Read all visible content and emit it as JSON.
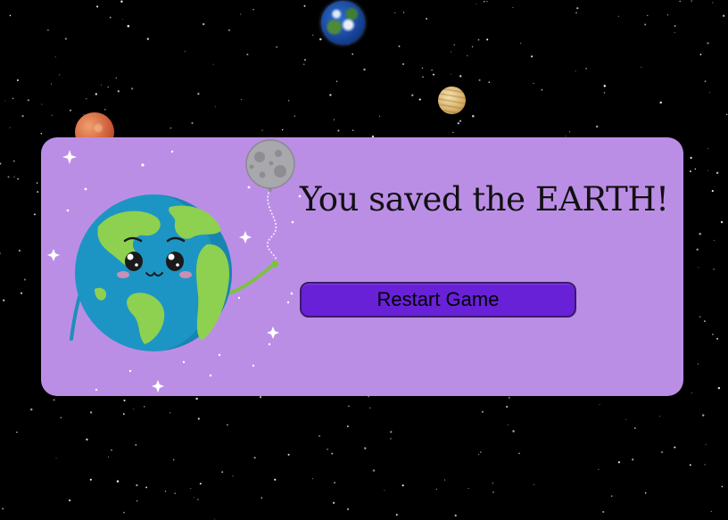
{
  "message": {
    "title": "You saved the EARTH!"
  },
  "actions": {
    "restart_label": "Restart Game"
  },
  "colors": {
    "background": "#000000",
    "card": "#bb8ee6",
    "button": "#6921d8",
    "button_border": "#3b1a6a"
  },
  "scene": {
    "planets": [
      "earth",
      "venus",
      "mars"
    ],
    "mascot": "earth-holding-moon-balloon"
  }
}
